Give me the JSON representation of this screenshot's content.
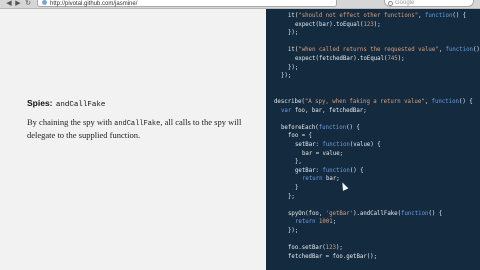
{
  "browser": {
    "url": "http://pivotal.github.com/jasmine/",
    "search_placeholder": "Google",
    "back_glyph": "◀",
    "forward_glyph": "▶",
    "reload_glyph": "↻"
  },
  "doc": {
    "section_title": "Spies:",
    "section_code": "andCallFake",
    "desc_before": "By chaining the spy with ",
    "desc_code": "andCallFake",
    "desc_after": ", all calls to the spy will delegate to the supplied function."
  },
  "code_lines": [
    {
      "indent": 2,
      "parts": [
        [
          "txt",
          "it("
        ],
        [
          "str",
          "\"should not effect other functions\""
        ],
        [
          "txt",
          ", "
        ],
        [
          "kw",
          "function"
        ],
        [
          "txt",
          "() {"
        ]
      ]
    },
    {
      "indent": 3,
      "parts": [
        [
          "txt",
          "expect(bar).toEqual("
        ],
        [
          "num",
          "123"
        ],
        [
          "txt",
          ");"
        ]
      ]
    },
    {
      "indent": 2,
      "parts": [
        [
          "txt",
          "});"
        ]
      ]
    },
    {
      "indent": 0,
      "parts": []
    },
    {
      "indent": 2,
      "parts": [
        [
          "txt",
          "it("
        ],
        [
          "str",
          "\"when called returns the requested value\""
        ],
        [
          "txt",
          ", "
        ],
        [
          "kw",
          "function"
        ],
        [
          "txt",
          "()"
        ]
      ]
    },
    {
      "indent": 3,
      "parts": [
        [
          "txt",
          "expect(fetchedBar).toEqual("
        ],
        [
          "num",
          "745"
        ],
        [
          "txt",
          ");"
        ]
      ]
    },
    {
      "indent": 2,
      "parts": [
        [
          "txt",
          "});"
        ]
      ]
    },
    {
      "indent": 1,
      "parts": [
        [
          "txt",
          "});"
        ]
      ]
    },
    {
      "indent": 0,
      "parts": []
    },
    {
      "indent": 0,
      "parts": []
    },
    {
      "indent": 0,
      "parts": [
        [
          "txt",
          "describe("
        ],
        [
          "str",
          "\"A spy, when faking a return value\""
        ],
        [
          "txt",
          ", "
        ],
        [
          "kw",
          "function"
        ],
        [
          "txt",
          "() {"
        ]
      ]
    },
    {
      "indent": 1,
      "parts": [
        [
          "kw",
          "var"
        ],
        [
          "txt",
          " foo, bar, fetchedBar;"
        ]
      ]
    },
    {
      "indent": 0,
      "parts": []
    },
    {
      "indent": 1,
      "parts": [
        [
          "txt",
          "beforeEach("
        ],
        [
          "kw",
          "function"
        ],
        [
          "txt",
          "() {"
        ]
      ]
    },
    {
      "indent": 2,
      "parts": [
        [
          "txt",
          "foo = {"
        ]
      ]
    },
    {
      "indent": 3,
      "parts": [
        [
          "txt",
          "setBar: "
        ],
        [
          "kw",
          "function"
        ],
        [
          "txt",
          "(value) {"
        ]
      ]
    },
    {
      "indent": 4,
      "parts": [
        [
          "txt",
          "bar = value;"
        ]
      ]
    },
    {
      "indent": 3,
      "parts": [
        [
          "txt",
          "},"
        ]
      ]
    },
    {
      "indent": 3,
      "parts": [
        [
          "txt",
          "getBar: "
        ],
        [
          "kw",
          "function"
        ],
        [
          "txt",
          "() {"
        ]
      ]
    },
    {
      "indent": 4,
      "parts": [
        [
          "kw",
          "return"
        ],
        [
          "txt",
          " bar;"
        ]
      ]
    },
    {
      "indent": 3,
      "parts": [
        [
          "txt",
          "}"
        ]
      ]
    },
    {
      "indent": 2,
      "parts": [
        [
          "txt",
          "};"
        ]
      ]
    },
    {
      "indent": 0,
      "parts": []
    },
    {
      "indent": 2,
      "parts": [
        [
          "txt",
          "spyOn(foo, "
        ],
        [
          "str",
          "'getBar'"
        ],
        [
          "txt",
          ").andCallFake("
        ],
        [
          "kw",
          "function"
        ],
        [
          "txt",
          "() {"
        ]
      ]
    },
    {
      "indent": 3,
      "parts": [
        [
          "kw",
          "return"
        ],
        [
          "txt",
          " "
        ],
        [
          "num",
          "1001"
        ],
        [
          "txt",
          ";"
        ]
      ]
    },
    {
      "indent": 2,
      "parts": [
        [
          "txt",
          "});"
        ]
      ]
    },
    {
      "indent": 0,
      "parts": []
    },
    {
      "indent": 2,
      "parts": [
        [
          "txt",
          "foo.setBar("
        ],
        [
          "num",
          "123"
        ],
        [
          "txt",
          ");"
        ]
      ]
    },
    {
      "indent": 2,
      "parts": [
        [
          "txt",
          "fetchedBar = foo.getBar();"
        ]
      ]
    }
  ]
}
